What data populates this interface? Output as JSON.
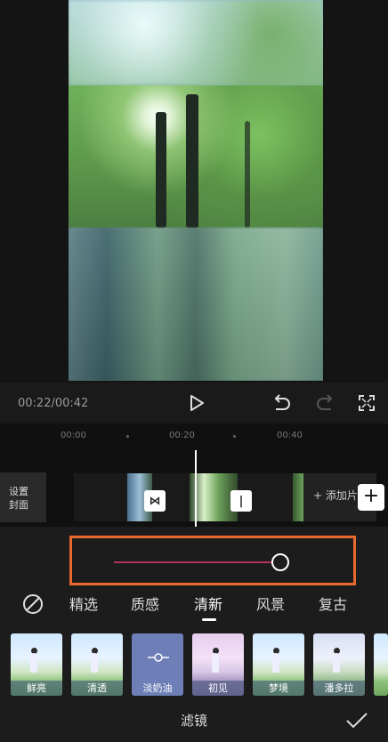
{
  "player": {
    "time": "00:22/00:42",
    "icons": [
      "play-icon",
      "undo-icon",
      "redo-icon",
      "fullscreen-icon"
    ]
  },
  "timeline": {
    "ruler": [
      "00:00",
      "00:20",
      "00:40"
    ],
    "cover_label_line1": "设置",
    "cover_label_line2": "封面",
    "add_clip_label": "+ 添加片",
    "add_button": "+"
  },
  "filter_strength": {
    "value": 0.95,
    "accent_color": "#b0305a",
    "highlight_color": "#e8692e"
  },
  "tabs": {
    "items": [
      "精选",
      "质感",
      "清新",
      "风景",
      "复古"
    ],
    "active": "清新"
  },
  "filters": {
    "items": [
      "鲜亮",
      "清透",
      "淡奶油",
      "初见",
      "梦境",
      "潘多拉"
    ],
    "selected": "淡奶油"
  },
  "bottom": {
    "title": "滤镜"
  }
}
